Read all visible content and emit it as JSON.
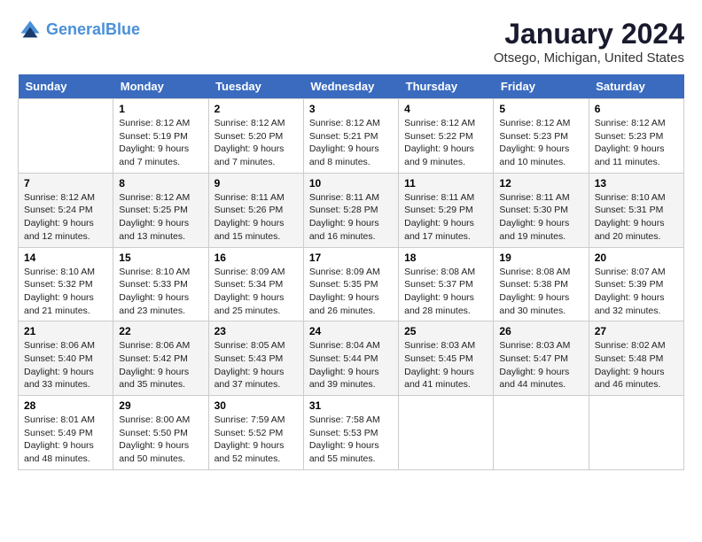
{
  "header": {
    "logo_line1": "General",
    "logo_line2": "Blue",
    "month_title": "January 2024",
    "location": "Otsego, Michigan, United States"
  },
  "weekdays": [
    "Sunday",
    "Monday",
    "Tuesday",
    "Wednesday",
    "Thursday",
    "Friday",
    "Saturday"
  ],
  "weeks": [
    [
      {
        "day": "",
        "sunrise": "",
        "sunset": "",
        "daylight": ""
      },
      {
        "day": "1",
        "sunrise": "Sunrise: 8:12 AM",
        "sunset": "Sunset: 5:19 PM",
        "daylight": "Daylight: 9 hours and 7 minutes."
      },
      {
        "day": "2",
        "sunrise": "Sunrise: 8:12 AM",
        "sunset": "Sunset: 5:20 PM",
        "daylight": "Daylight: 9 hours and 7 minutes."
      },
      {
        "day": "3",
        "sunrise": "Sunrise: 8:12 AM",
        "sunset": "Sunset: 5:21 PM",
        "daylight": "Daylight: 9 hours and 8 minutes."
      },
      {
        "day": "4",
        "sunrise": "Sunrise: 8:12 AM",
        "sunset": "Sunset: 5:22 PM",
        "daylight": "Daylight: 9 hours and 9 minutes."
      },
      {
        "day": "5",
        "sunrise": "Sunrise: 8:12 AM",
        "sunset": "Sunset: 5:23 PM",
        "daylight": "Daylight: 9 hours and 10 minutes."
      },
      {
        "day": "6",
        "sunrise": "Sunrise: 8:12 AM",
        "sunset": "Sunset: 5:23 PM",
        "daylight": "Daylight: 9 hours and 11 minutes."
      }
    ],
    [
      {
        "day": "7",
        "sunrise": "Sunrise: 8:12 AM",
        "sunset": "Sunset: 5:24 PM",
        "daylight": "Daylight: 9 hours and 12 minutes."
      },
      {
        "day": "8",
        "sunrise": "Sunrise: 8:12 AM",
        "sunset": "Sunset: 5:25 PM",
        "daylight": "Daylight: 9 hours and 13 minutes."
      },
      {
        "day": "9",
        "sunrise": "Sunrise: 8:11 AM",
        "sunset": "Sunset: 5:26 PM",
        "daylight": "Daylight: 9 hours and 15 minutes."
      },
      {
        "day": "10",
        "sunrise": "Sunrise: 8:11 AM",
        "sunset": "Sunset: 5:28 PM",
        "daylight": "Daylight: 9 hours and 16 minutes."
      },
      {
        "day": "11",
        "sunrise": "Sunrise: 8:11 AM",
        "sunset": "Sunset: 5:29 PM",
        "daylight": "Daylight: 9 hours and 17 minutes."
      },
      {
        "day": "12",
        "sunrise": "Sunrise: 8:11 AM",
        "sunset": "Sunset: 5:30 PM",
        "daylight": "Daylight: 9 hours and 19 minutes."
      },
      {
        "day": "13",
        "sunrise": "Sunrise: 8:10 AM",
        "sunset": "Sunset: 5:31 PM",
        "daylight": "Daylight: 9 hours and 20 minutes."
      }
    ],
    [
      {
        "day": "14",
        "sunrise": "Sunrise: 8:10 AM",
        "sunset": "Sunset: 5:32 PM",
        "daylight": "Daylight: 9 hours and 21 minutes."
      },
      {
        "day": "15",
        "sunrise": "Sunrise: 8:10 AM",
        "sunset": "Sunset: 5:33 PM",
        "daylight": "Daylight: 9 hours and 23 minutes."
      },
      {
        "day": "16",
        "sunrise": "Sunrise: 8:09 AM",
        "sunset": "Sunset: 5:34 PM",
        "daylight": "Daylight: 9 hours and 25 minutes."
      },
      {
        "day": "17",
        "sunrise": "Sunrise: 8:09 AM",
        "sunset": "Sunset: 5:35 PM",
        "daylight": "Daylight: 9 hours and 26 minutes."
      },
      {
        "day": "18",
        "sunrise": "Sunrise: 8:08 AM",
        "sunset": "Sunset: 5:37 PM",
        "daylight": "Daylight: 9 hours and 28 minutes."
      },
      {
        "day": "19",
        "sunrise": "Sunrise: 8:08 AM",
        "sunset": "Sunset: 5:38 PM",
        "daylight": "Daylight: 9 hours and 30 minutes."
      },
      {
        "day": "20",
        "sunrise": "Sunrise: 8:07 AM",
        "sunset": "Sunset: 5:39 PM",
        "daylight": "Daylight: 9 hours and 32 minutes."
      }
    ],
    [
      {
        "day": "21",
        "sunrise": "Sunrise: 8:06 AM",
        "sunset": "Sunset: 5:40 PM",
        "daylight": "Daylight: 9 hours and 33 minutes."
      },
      {
        "day": "22",
        "sunrise": "Sunrise: 8:06 AM",
        "sunset": "Sunset: 5:42 PM",
        "daylight": "Daylight: 9 hours and 35 minutes."
      },
      {
        "day": "23",
        "sunrise": "Sunrise: 8:05 AM",
        "sunset": "Sunset: 5:43 PM",
        "daylight": "Daylight: 9 hours and 37 minutes."
      },
      {
        "day": "24",
        "sunrise": "Sunrise: 8:04 AM",
        "sunset": "Sunset: 5:44 PM",
        "daylight": "Daylight: 9 hours and 39 minutes."
      },
      {
        "day": "25",
        "sunrise": "Sunrise: 8:03 AM",
        "sunset": "Sunset: 5:45 PM",
        "daylight": "Daylight: 9 hours and 41 minutes."
      },
      {
        "day": "26",
        "sunrise": "Sunrise: 8:03 AM",
        "sunset": "Sunset: 5:47 PM",
        "daylight": "Daylight: 9 hours and 44 minutes."
      },
      {
        "day": "27",
        "sunrise": "Sunrise: 8:02 AM",
        "sunset": "Sunset: 5:48 PM",
        "daylight": "Daylight: 9 hours and 46 minutes."
      }
    ],
    [
      {
        "day": "28",
        "sunrise": "Sunrise: 8:01 AM",
        "sunset": "Sunset: 5:49 PM",
        "daylight": "Daylight: 9 hours and 48 minutes."
      },
      {
        "day": "29",
        "sunrise": "Sunrise: 8:00 AM",
        "sunset": "Sunset: 5:50 PM",
        "daylight": "Daylight: 9 hours and 50 minutes."
      },
      {
        "day": "30",
        "sunrise": "Sunrise: 7:59 AM",
        "sunset": "Sunset: 5:52 PM",
        "daylight": "Daylight: 9 hours and 52 minutes."
      },
      {
        "day": "31",
        "sunrise": "Sunrise: 7:58 AM",
        "sunset": "Sunset: 5:53 PM",
        "daylight": "Daylight: 9 hours and 55 minutes."
      },
      {
        "day": "",
        "sunrise": "",
        "sunset": "",
        "daylight": ""
      },
      {
        "day": "",
        "sunrise": "",
        "sunset": "",
        "daylight": ""
      },
      {
        "day": "",
        "sunrise": "",
        "sunset": "",
        "daylight": ""
      }
    ]
  ]
}
